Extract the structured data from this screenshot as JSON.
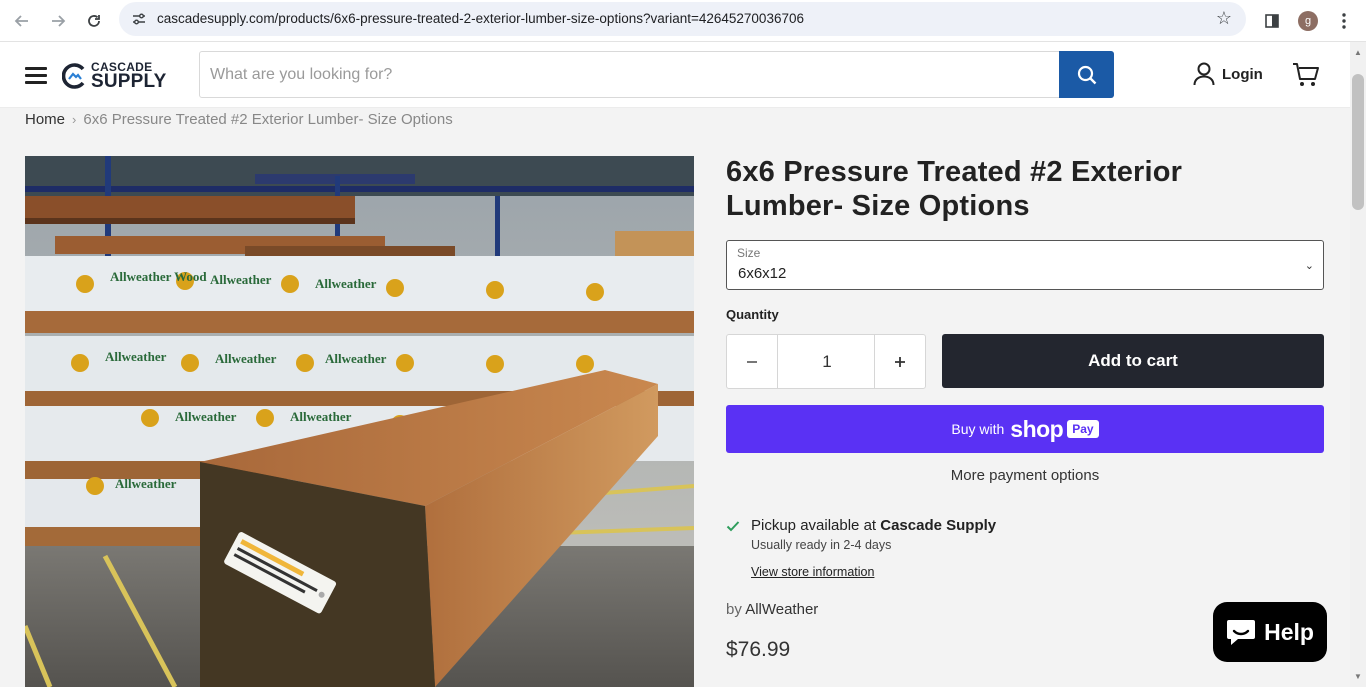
{
  "browser": {
    "url": "cascadesupply.com/products/6x6-pressure-treated-2-exterior-lumber-size-options?variant=42645270036706",
    "profile_initial": "g"
  },
  "header": {
    "logo_line1": "CASCADE",
    "logo_line2": "SUPPLY",
    "search_placeholder": "What are you looking for?",
    "login_label": "Login"
  },
  "breadcrumb": {
    "home": "Home",
    "separator": "›",
    "current": "6x6 Pressure Treated #2 Exterior Lumber- Size Options"
  },
  "product": {
    "title": "6x6 Pressure Treated #2 Exterior Lumber- Size Options",
    "size_label": "Size",
    "size_value": "6x6x12",
    "quantity_label": "Quantity",
    "quantity_value": "1",
    "add_to_cart": "Add to cart",
    "buy_with": "Buy with",
    "shop_word": "shop",
    "pay_word": "Pay",
    "more_payment": "More payment options",
    "pickup_prefix": "Pickup available at",
    "pickup_store": "Cascade Supply",
    "pickup_ready": "Usually ready in 2-4 days",
    "store_info_link": "View store information",
    "vendor_prefix": "by",
    "vendor": "AllWeather",
    "price": "$76.99"
  },
  "image_text": {
    "wrap_brand": "Allweather Wood"
  },
  "chat": {
    "label": "Help"
  },
  "colors": {
    "search_button": "#1b5aa6",
    "add_to_cart_bg": "#23262f",
    "shop_pay_bg": "#5a31f4",
    "check": "#2e9d5c"
  }
}
